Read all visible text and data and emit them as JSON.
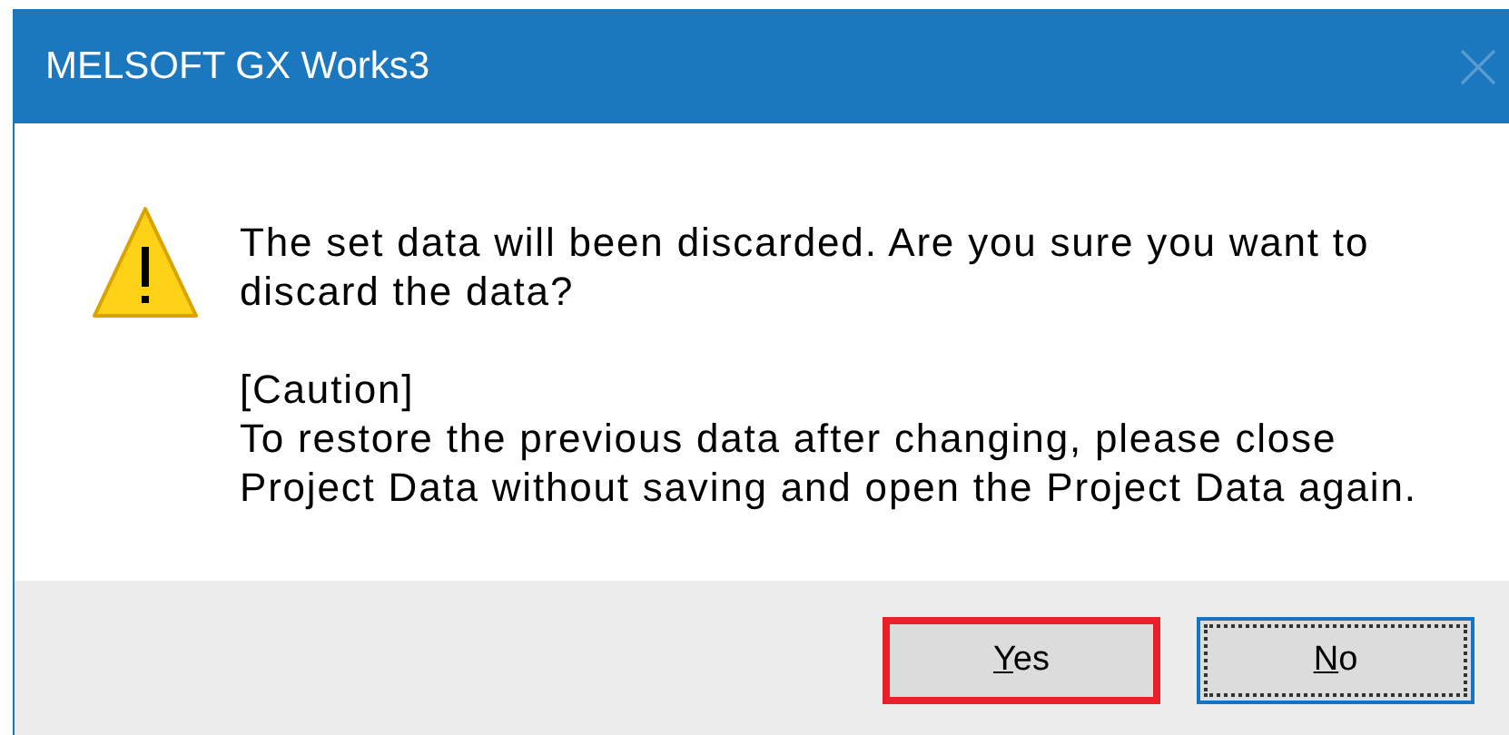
{
  "window": {
    "title": "MELSOFT GX Works3",
    "close_disabled": true
  },
  "message": {
    "text": "The set data will been discarded. Are you sure you want to discard the data?",
    "caution_heading": "[Caution]",
    "caution_text": "To restore the previous data after changing, please close Project Data without saving and open the Project Data again."
  },
  "buttons": [
    {
      "label": "Yes",
      "focused": false,
      "highlighted": true
    },
    {
      "label": "No",
      "focused": true,
      "highlighted": false
    }
  ]
}
